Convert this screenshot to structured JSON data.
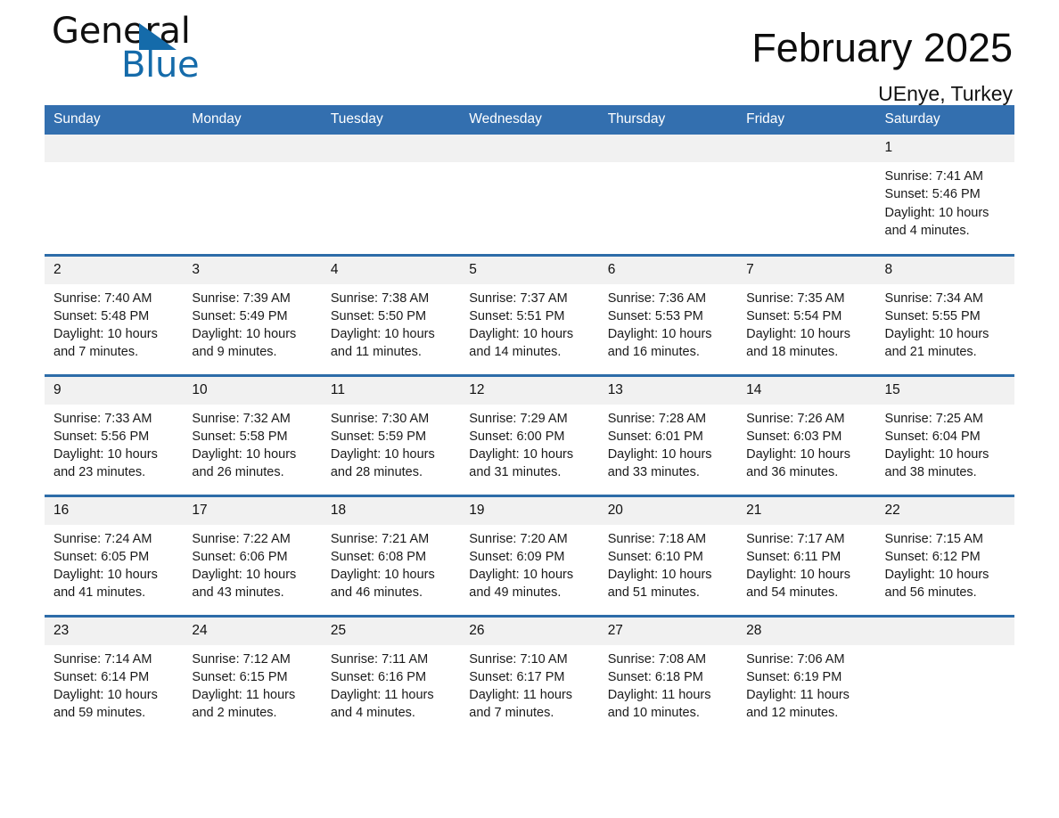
{
  "brand": {
    "name_part1": "General",
    "name_part2": "Blue",
    "triangle_color": "#156BAA"
  },
  "header": {
    "title": "February 2025",
    "subtitle": "UEnye, Turkey"
  },
  "theme": {
    "header_blue": "#336FAF",
    "row_rule_blue": "#2D6CA8",
    "daynum_band": "#F1F1F1",
    "text": "#1a1a1a"
  },
  "weekday_headers": [
    "Sunday",
    "Monday",
    "Tuesday",
    "Wednesday",
    "Thursday",
    "Friday",
    "Saturday"
  ],
  "weeks": [
    [
      {
        "date": "",
        "sunrise": "",
        "sunset": "",
        "daylight": "",
        "blank": true
      },
      {
        "date": "",
        "sunrise": "",
        "sunset": "",
        "daylight": "",
        "blank": true
      },
      {
        "date": "",
        "sunrise": "",
        "sunset": "",
        "daylight": "",
        "blank": true
      },
      {
        "date": "",
        "sunrise": "",
        "sunset": "",
        "daylight": "",
        "blank": true
      },
      {
        "date": "",
        "sunrise": "",
        "sunset": "",
        "daylight": "",
        "blank": true
      },
      {
        "date": "",
        "sunrise": "",
        "sunset": "",
        "daylight": "",
        "blank": true
      },
      {
        "date": "1",
        "sunrise": "Sunrise: 7:41 AM",
        "sunset": "Sunset: 5:46 PM",
        "daylight": "Daylight: 10 hours and 4 minutes.",
        "blank": false
      }
    ],
    [
      {
        "date": "2",
        "sunrise": "Sunrise: 7:40 AM",
        "sunset": "Sunset: 5:48 PM",
        "daylight": "Daylight: 10 hours and 7 minutes.",
        "blank": false
      },
      {
        "date": "3",
        "sunrise": "Sunrise: 7:39 AM",
        "sunset": "Sunset: 5:49 PM",
        "daylight": "Daylight: 10 hours and 9 minutes.",
        "blank": false
      },
      {
        "date": "4",
        "sunrise": "Sunrise: 7:38 AM",
        "sunset": "Sunset: 5:50 PM",
        "daylight": "Daylight: 10 hours and 11 minutes.",
        "blank": false
      },
      {
        "date": "5",
        "sunrise": "Sunrise: 7:37 AM",
        "sunset": "Sunset: 5:51 PM",
        "daylight": "Daylight: 10 hours and 14 minutes.",
        "blank": false
      },
      {
        "date": "6",
        "sunrise": "Sunrise: 7:36 AM",
        "sunset": "Sunset: 5:53 PM",
        "daylight": "Daylight: 10 hours and 16 minutes.",
        "blank": false
      },
      {
        "date": "7",
        "sunrise": "Sunrise: 7:35 AM",
        "sunset": "Sunset: 5:54 PM",
        "daylight": "Daylight: 10 hours and 18 minutes.",
        "blank": false
      },
      {
        "date": "8",
        "sunrise": "Sunrise: 7:34 AM",
        "sunset": "Sunset: 5:55 PM",
        "daylight": "Daylight: 10 hours and 21 minutes.",
        "blank": false
      }
    ],
    [
      {
        "date": "9",
        "sunrise": "Sunrise: 7:33 AM",
        "sunset": "Sunset: 5:56 PM",
        "daylight": "Daylight: 10 hours and 23 minutes.",
        "blank": false
      },
      {
        "date": "10",
        "sunrise": "Sunrise: 7:32 AM",
        "sunset": "Sunset: 5:58 PM",
        "daylight": "Daylight: 10 hours and 26 minutes.",
        "blank": false
      },
      {
        "date": "11",
        "sunrise": "Sunrise: 7:30 AM",
        "sunset": "Sunset: 5:59 PM",
        "daylight": "Daylight: 10 hours and 28 minutes.",
        "blank": false
      },
      {
        "date": "12",
        "sunrise": "Sunrise: 7:29 AM",
        "sunset": "Sunset: 6:00 PM",
        "daylight": "Daylight: 10 hours and 31 minutes.",
        "blank": false
      },
      {
        "date": "13",
        "sunrise": "Sunrise: 7:28 AM",
        "sunset": "Sunset: 6:01 PM",
        "daylight": "Daylight: 10 hours and 33 minutes.",
        "blank": false
      },
      {
        "date": "14",
        "sunrise": "Sunrise: 7:26 AM",
        "sunset": "Sunset: 6:03 PM",
        "daylight": "Daylight: 10 hours and 36 minutes.",
        "blank": false
      },
      {
        "date": "15",
        "sunrise": "Sunrise: 7:25 AM",
        "sunset": "Sunset: 6:04 PM",
        "daylight": "Daylight: 10 hours and 38 minutes.",
        "blank": false
      }
    ],
    [
      {
        "date": "16",
        "sunrise": "Sunrise: 7:24 AM",
        "sunset": "Sunset: 6:05 PM",
        "daylight": "Daylight: 10 hours and 41 minutes.",
        "blank": false
      },
      {
        "date": "17",
        "sunrise": "Sunrise: 7:22 AM",
        "sunset": "Sunset: 6:06 PM",
        "daylight": "Daylight: 10 hours and 43 minutes.",
        "blank": false
      },
      {
        "date": "18",
        "sunrise": "Sunrise: 7:21 AM",
        "sunset": "Sunset: 6:08 PM",
        "daylight": "Daylight: 10 hours and 46 minutes.",
        "blank": false
      },
      {
        "date": "19",
        "sunrise": "Sunrise: 7:20 AM",
        "sunset": "Sunset: 6:09 PM",
        "daylight": "Daylight: 10 hours and 49 minutes.",
        "blank": false
      },
      {
        "date": "20",
        "sunrise": "Sunrise: 7:18 AM",
        "sunset": "Sunset: 6:10 PM",
        "daylight": "Daylight: 10 hours and 51 minutes.",
        "blank": false
      },
      {
        "date": "21",
        "sunrise": "Sunrise: 7:17 AM",
        "sunset": "Sunset: 6:11 PM",
        "daylight": "Daylight: 10 hours and 54 minutes.",
        "blank": false
      },
      {
        "date": "22",
        "sunrise": "Sunrise: 7:15 AM",
        "sunset": "Sunset: 6:12 PM",
        "daylight": "Daylight: 10 hours and 56 minutes.",
        "blank": false
      }
    ],
    [
      {
        "date": "23",
        "sunrise": "Sunrise: 7:14 AM",
        "sunset": "Sunset: 6:14 PM",
        "daylight": "Daylight: 10 hours and 59 minutes.",
        "blank": false
      },
      {
        "date": "24",
        "sunrise": "Sunrise: 7:12 AM",
        "sunset": "Sunset: 6:15 PM",
        "daylight": "Daylight: 11 hours and 2 minutes.",
        "blank": false
      },
      {
        "date": "25",
        "sunrise": "Sunrise: 7:11 AM",
        "sunset": "Sunset: 6:16 PM",
        "daylight": "Daylight: 11 hours and 4 minutes.",
        "blank": false
      },
      {
        "date": "26",
        "sunrise": "Sunrise: 7:10 AM",
        "sunset": "Sunset: 6:17 PM",
        "daylight": "Daylight: 11 hours and 7 minutes.",
        "blank": false
      },
      {
        "date": "27",
        "sunrise": "Sunrise: 7:08 AM",
        "sunset": "Sunset: 6:18 PM",
        "daylight": "Daylight: 11 hours and 10 minutes.",
        "blank": false
      },
      {
        "date": "28",
        "sunrise": "Sunrise: 7:06 AM",
        "sunset": "Sunset: 6:19 PM",
        "daylight": "Daylight: 11 hours and 12 minutes.",
        "blank": false
      },
      {
        "date": "",
        "sunrise": "",
        "sunset": "",
        "daylight": "",
        "blank": true
      }
    ]
  ]
}
